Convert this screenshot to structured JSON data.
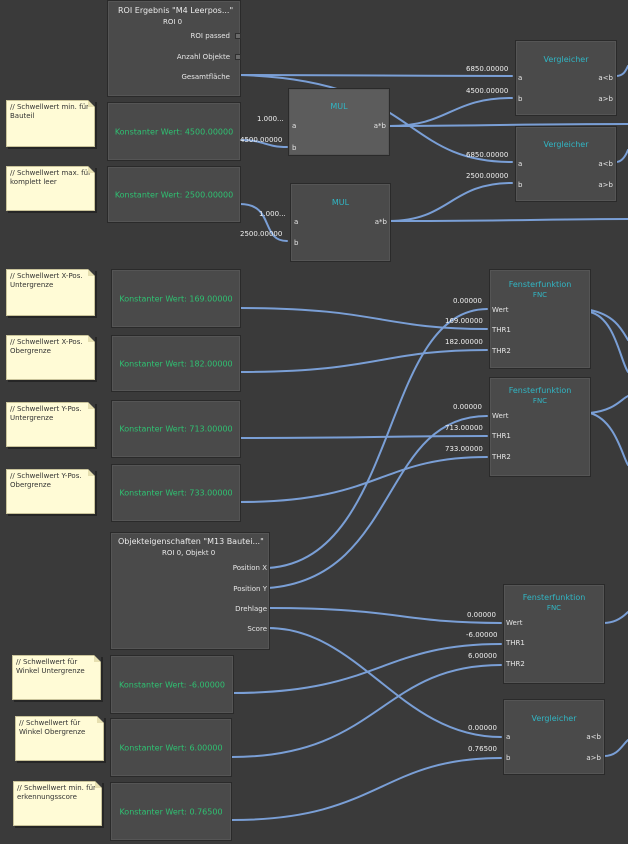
{
  "colors": {
    "background": "#3a3a3a",
    "wire": "#7a9fd6",
    "title": "#31b6c4",
    "constant": "#2fc172",
    "note": "#fffbd6"
  },
  "roi": {
    "title": "ROI Ergebnis \"M4 Leerpos...\"",
    "subtitle": "ROI 0",
    "ports": [
      "ROI passed",
      "Anzahl Objekte",
      "Gesamtfläche"
    ]
  },
  "obj": {
    "title": "Objekteigenschaften \"M13 Bautei...\"",
    "subtitle": "ROI 0, Objekt 0",
    "ports": [
      "Position X",
      "Position Y",
      "Drehlage",
      "Score"
    ]
  },
  "notes": [
    "// Schwellwert min. für Bauteil",
    "// Schwellwert max. für komplett leer",
    "// Schwellwert X-Pos. Untergrenze",
    "// Schwellwert X-Pos. Obergrenze",
    "// Schwellwert Y-Pos. Untergrenze",
    "// Schwellwert Y-Pos. Obergrenze",
    "// Schwellwert für Winkel Untergrenze",
    "// Schwellwert für Winkel Obergrenze",
    "// Schwellwert min. für erkennungsscore"
  ],
  "constants": [
    "Konstanter Wert: 4500.00000",
    "Konstanter Wert: 2500.00000",
    "Konstanter Wert: 169.00000",
    "Konstanter Wert: 182.00000",
    "Konstanter Wert: 713.00000",
    "Konstanter Wert: 733.00000",
    "Konstanter Wert: -6.00000",
    "Konstanter Wert: 6.00000",
    "Konstanter Wert: 0.76500"
  ],
  "mul": [
    {
      "title": "MUL",
      "in_a": "a",
      "in_b": "b",
      "out": "a*b",
      "val_a": "1.000...",
      "val_b": "4500.00000"
    },
    {
      "title": "MUL",
      "in_a": "a",
      "in_b": "b",
      "out": "a*b",
      "val_a": "1.000...",
      "val_b": "2500.00000"
    }
  ],
  "comparators": [
    {
      "title": "Vergleicher",
      "in_a": "a",
      "in_b": "b",
      "out_lt": "a<b",
      "out_gt": "a>b",
      "val_a": "6850.00000",
      "val_b": "4500.00000"
    },
    {
      "title": "Vergleicher",
      "in_a": "a",
      "in_b": "b",
      "out_lt": "a<b",
      "out_gt": "a>b",
      "val_a": "6850.00000",
      "val_b": "2500.00000"
    },
    {
      "title": "Vergleicher",
      "in_a": "a",
      "in_b": "b",
      "out_lt": "a<b",
      "out_gt": "a>b",
      "val_a": "0.00000",
      "val_b": "0.76500"
    }
  ],
  "windows": [
    {
      "title": "Fensterfunktion",
      "sub": "FNC",
      "p1": "Wert",
      "p2": "THR1",
      "p3": "THR2",
      "v1": "0.00000",
      "v2": "169.00000",
      "v3": "182.00000"
    },
    {
      "title": "Fensterfunktion",
      "sub": "FNC",
      "p1": "Wert",
      "p2": "THR1",
      "p3": "THR2",
      "v1": "0.00000",
      "v2": "713.00000",
      "v3": "733.00000"
    },
    {
      "title": "Fensterfunktion",
      "sub": "FNC",
      "p1": "Wert",
      "p2": "THR1",
      "p3": "THR2",
      "v1": "0.00000",
      "v2": "-6.00000",
      "v3": "6.00000"
    }
  ]
}
